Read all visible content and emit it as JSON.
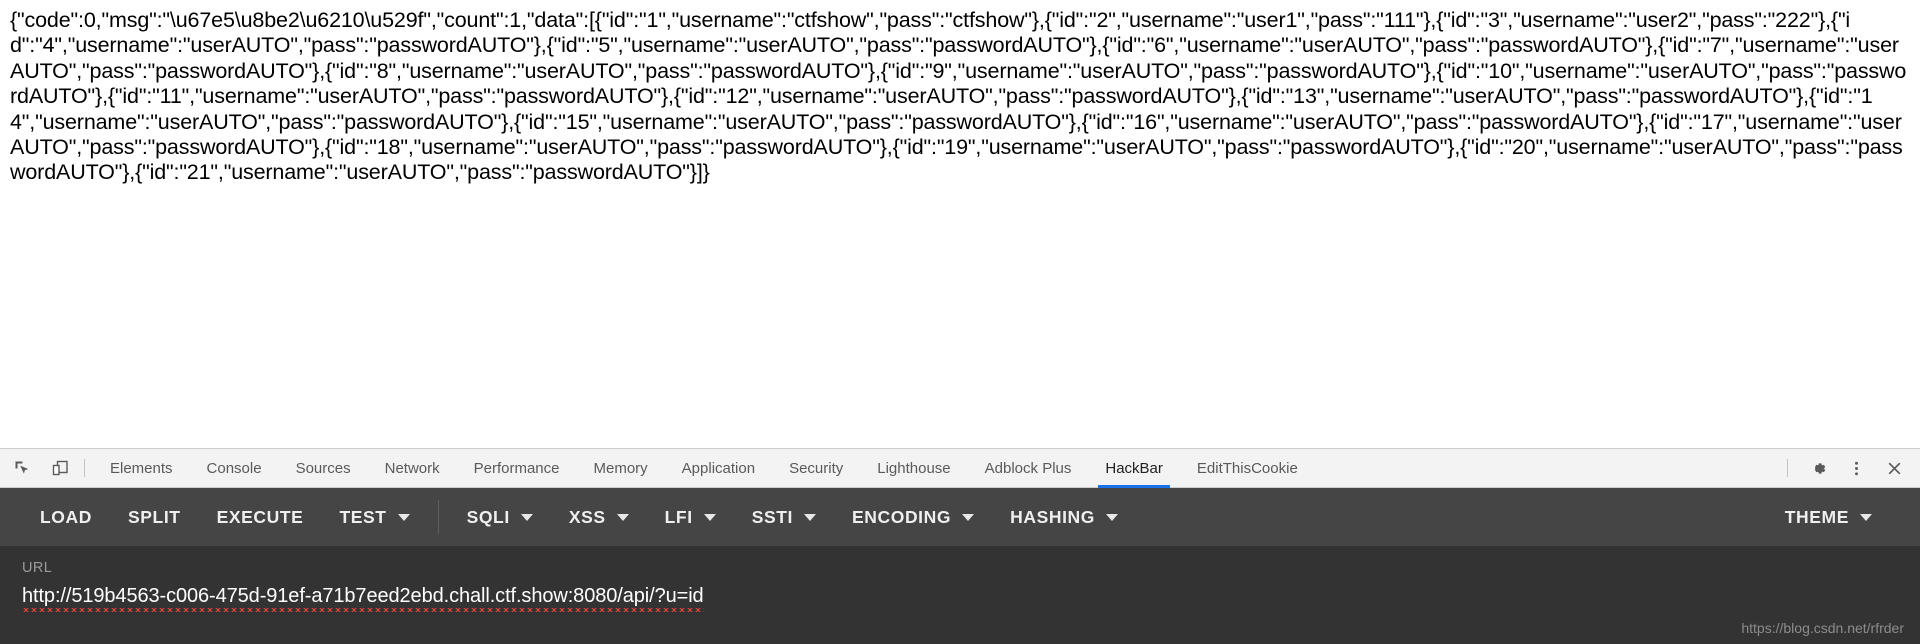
{
  "response": {
    "body": "{\"code\":0,\"msg\":\"\\u67e5\\u8be2\\u6210\\u529f\",\"count\":1,\"data\":[{\"id\":\"1\",\"username\":\"ctfshow\",\"pass\":\"ctfshow\"},{\"id\":\"2\",\"username\":\"user1\",\"pass\":\"111\"},{\"id\":\"3\",\"username\":\"user2\",\"pass\":\"222\"},{\"id\":\"4\",\"username\":\"userAUTO\",\"pass\":\"passwordAUTO\"},{\"id\":\"5\",\"username\":\"userAUTO\",\"pass\":\"passwordAUTO\"},{\"id\":\"6\",\"username\":\"userAUTO\",\"pass\":\"passwordAUTO\"},{\"id\":\"7\",\"username\":\"userAUTO\",\"pass\":\"passwordAUTO\"},{\"id\":\"8\",\"username\":\"userAUTO\",\"pass\":\"passwordAUTO\"},{\"id\":\"9\",\"username\":\"userAUTO\",\"pass\":\"passwordAUTO\"},{\"id\":\"10\",\"username\":\"userAUTO\",\"pass\":\"passwordAUTO\"},{\"id\":\"11\",\"username\":\"userAUTO\",\"pass\":\"passwordAUTO\"},{\"id\":\"12\",\"username\":\"userAUTO\",\"pass\":\"passwordAUTO\"},{\"id\":\"13\",\"username\":\"userAUTO\",\"pass\":\"passwordAUTO\"},{\"id\":\"14\",\"username\":\"userAUTO\",\"pass\":\"passwordAUTO\"},{\"id\":\"15\",\"username\":\"userAUTO\",\"pass\":\"passwordAUTO\"},{\"id\":\"16\",\"username\":\"userAUTO\",\"pass\":\"passwordAUTO\"},{\"id\":\"17\",\"username\":\"userAUTO\",\"pass\":\"passwordAUTO\"},{\"id\":\"18\",\"username\":\"userAUTO\",\"pass\":\"passwordAUTO\"},{\"id\":\"19\",\"username\":\"userAUTO\",\"pass\":\"passwordAUTO\"},{\"id\":\"20\",\"username\":\"userAUTO\",\"pass\":\"passwordAUTO\"},{\"id\":\"21\",\"username\":\"userAUTO\",\"pass\":\"passwordAUTO\"}]}"
  },
  "devtools": {
    "icons": {
      "inspect": "inspect-element-icon",
      "device": "device-toolbar-icon",
      "settings": "gear-icon",
      "more": "kebab-menu-icon",
      "close": "close-icon"
    },
    "tabs": [
      {
        "label": "Elements",
        "active": false
      },
      {
        "label": "Console",
        "active": false
      },
      {
        "label": "Sources",
        "active": false
      },
      {
        "label": "Network",
        "active": false
      },
      {
        "label": "Performance",
        "active": false
      },
      {
        "label": "Memory",
        "active": false
      },
      {
        "label": "Application",
        "active": false
      },
      {
        "label": "Security",
        "active": false
      },
      {
        "label": "Lighthouse",
        "active": false
      },
      {
        "label": "Adblock Plus",
        "active": false
      },
      {
        "label": "HackBar",
        "active": true
      },
      {
        "label": "EditThisCookie",
        "active": false
      }
    ],
    "active_tab_accent": "#1a73e8"
  },
  "hackbar": {
    "buttons": [
      {
        "label": "LOAD",
        "caret": false
      },
      {
        "label": "SPLIT",
        "caret": false
      },
      {
        "label": "EXECUTE",
        "caret": false
      },
      {
        "label": "TEST",
        "caret": true
      },
      {
        "label": "SQLI",
        "caret": true
      },
      {
        "label": "XSS",
        "caret": true
      },
      {
        "label": "LFI",
        "caret": true
      },
      {
        "label": "SSTI",
        "caret": true
      },
      {
        "label": "ENCODING",
        "caret": true
      },
      {
        "label": "HASHING",
        "caret": true
      }
    ],
    "theme_button": {
      "label": "THEME",
      "caret": true
    },
    "url": {
      "label": "URL",
      "value": "http://519b4563-c006-475d-91ef-a71b7eed2ebd.chall.ctf.show:8080/api/?u=id"
    }
  },
  "watermark": "https://blog.csdn.net/rfrder"
}
